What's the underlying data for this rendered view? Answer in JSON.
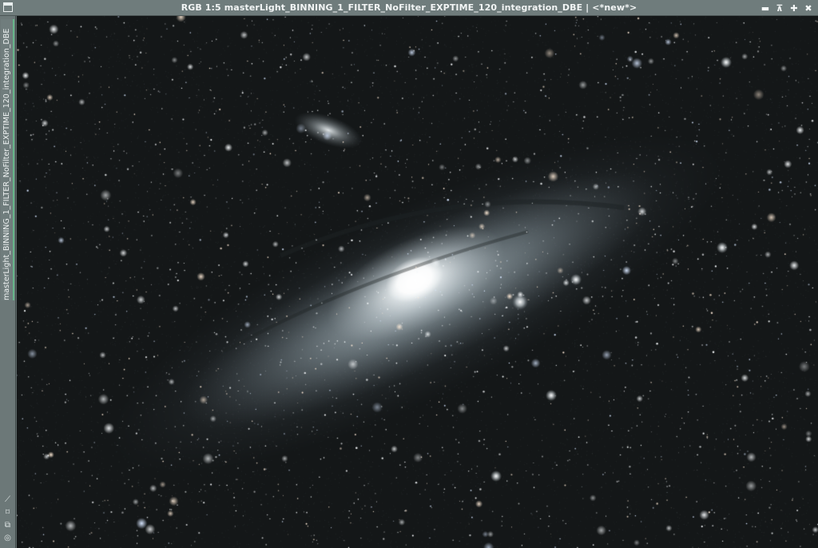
{
  "window": {
    "title": "RGB 1:5 masterLight_BINNING_1_FILTER_NoFilter_EXPTIME_120_integration_DBE | <*new*>",
    "icon": "window-icon",
    "buttons": [
      {
        "name": "minimize-button",
        "glyph": "▬"
      },
      {
        "name": "shade-button",
        "glyph": "⊼"
      },
      {
        "name": "maximize-button",
        "glyph": "✚"
      },
      {
        "name": "close-button",
        "glyph": "✖"
      }
    ]
  },
  "sidebar": {
    "tab_label": "masterLight_BINNING_1_FILTER_NoFilter_EXPTIME_120_integration_DBE",
    "tab_accent": "#67b58a",
    "icons": [
      {
        "name": "collapse-icon",
        "glyph": "⟋"
      },
      {
        "name": "fit-icon",
        "glyph": "⌑"
      },
      {
        "name": "clone-icon",
        "glyph": "⧉"
      },
      {
        "name": "target-icon",
        "glyph": "◎"
      }
    ]
  },
  "image": {
    "subject": "Andromeda Galaxy astrophotograph",
    "background_color": "#141718"
  }
}
